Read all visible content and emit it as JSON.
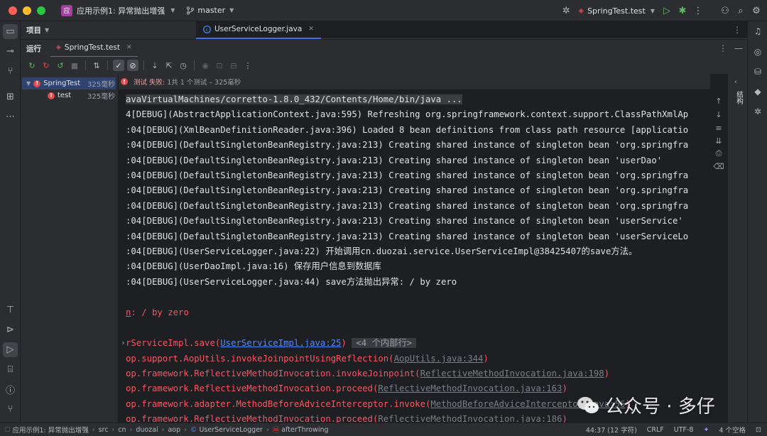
{
  "titlebar": {
    "project_badge": "应",
    "project_name": "应用示例1: 异常抛出增强",
    "branch": "master",
    "run_config": "SpringTest.test"
  },
  "project_panel": {
    "title": "项目"
  },
  "editor_tab": {
    "label": "UserServiceLogger.java"
  },
  "run_panel": {
    "label": "运行",
    "tab_label": "SpringTest.test"
  },
  "test_tree": {
    "items": [
      {
        "label": "SpringTest",
        "time": "325毫秒",
        "status": "failed"
      },
      {
        "label": "test",
        "time": "325毫秒",
        "status": "failed"
      }
    ]
  },
  "status_line": {
    "failed_label": "测试 失败:",
    "summary": "1共 1 个测试 – 325毫秒"
  },
  "console": {
    "line0": "avaVirtualMachines/corretto-1.8.0_432/Contents/Home/bin/java ...",
    "line1": "4[DEBUG](AbstractApplicationContext.java:595) Refreshing org.springframework.context.support.ClassPathXmlAp",
    "line2": ":04[DEBUG](XmlBeanDefinitionReader.java:396) Loaded 8 bean definitions from class path resource [applicatio",
    "line3": ":04[DEBUG](DefaultSingletonBeanRegistry.java:213) Creating shared instance of singleton bean 'org.springfra",
    "line4": ":04[DEBUG](DefaultSingletonBeanRegistry.java:213) Creating shared instance of singleton bean 'userDao'",
    "line5": ":04[DEBUG](DefaultSingletonBeanRegistry.java:213) Creating shared instance of singleton bean 'org.springfra",
    "line6": ":04[DEBUG](DefaultSingletonBeanRegistry.java:213) Creating shared instance of singleton bean 'org.springfra",
    "line7": ":04[DEBUG](DefaultSingletonBeanRegistry.java:213) Creating shared instance of singleton bean 'org.springfra",
    "line8": ":04[DEBUG](DefaultSingletonBeanRegistry.java:213) Creating shared instance of singleton bean 'userService'",
    "line9": ":04[DEBUG](DefaultSingletonBeanRegistry.java:213) Creating shared instance of singleton bean 'userServiceLo",
    "line10": ":04[DEBUG](UserServiceLogger.java:22) 开始调用cn.duozai.service.UserServiceImpl@38425407的save方法。",
    "line11": ":04[DEBUG](UserDaoImpl.java:16) 保存用户信息到数据库",
    "line12": ":04[DEBUG](UserServiceLogger.java:44) save方法抛出异常: / by zero",
    "err_head_prefix": "n",
    "err_head_rest": ": / by zero",
    "trace0_pre": "rServiceImpl.save(",
    "trace0_link": "UserServiceImpl.java:25",
    "trace0_post": ")",
    "trace0_fold": "<4 个内部行>",
    "trace1_pre": "op.support.AopUtils.invokeJoinpointUsingReflection(",
    "trace1_link": "AopUtils.java:344",
    "trace2_pre": "op.framework.ReflectiveMethodInvocation.invokeJoinpoint(",
    "trace2_link": "ReflectiveMethodInvocation.java:198",
    "trace3_pre": "op.framework.ReflectiveMethodInvocation.proceed(",
    "trace3_link": "ReflectiveMethodInvocation.java:163",
    "trace4_pre": "op.framework.adapter.MethodBeforeAdviceInterceptor.invoke(",
    "trace4_link": "MethodBeforeAdviceInterceptor.java:56",
    "trace5_pre": "op.framework.ReflectiveMethodInvocation.proceed(",
    "trace5_link": "ReflectiveMethodInvocation.java:186",
    "close_paren": ")"
  },
  "structure_sidebar": {
    "label": "结构"
  },
  "watermark": {
    "text": "公众号 · 多仔"
  },
  "statusbar": {
    "crumbs": [
      "应用示例1: 异常抛出增强",
      "src",
      "cn",
      "duozai",
      "aop",
      "UserServiceLogger",
      "afterThrowing"
    ],
    "position": "44:37 (12 字符)",
    "line_ending": "CRLF",
    "encoding": "UTF-8",
    "indent": "4 个空格"
  },
  "colors": {
    "accent": "#3574f0",
    "error": "#f75464",
    "link": "#548af7",
    "badge": "#a23fa1"
  }
}
